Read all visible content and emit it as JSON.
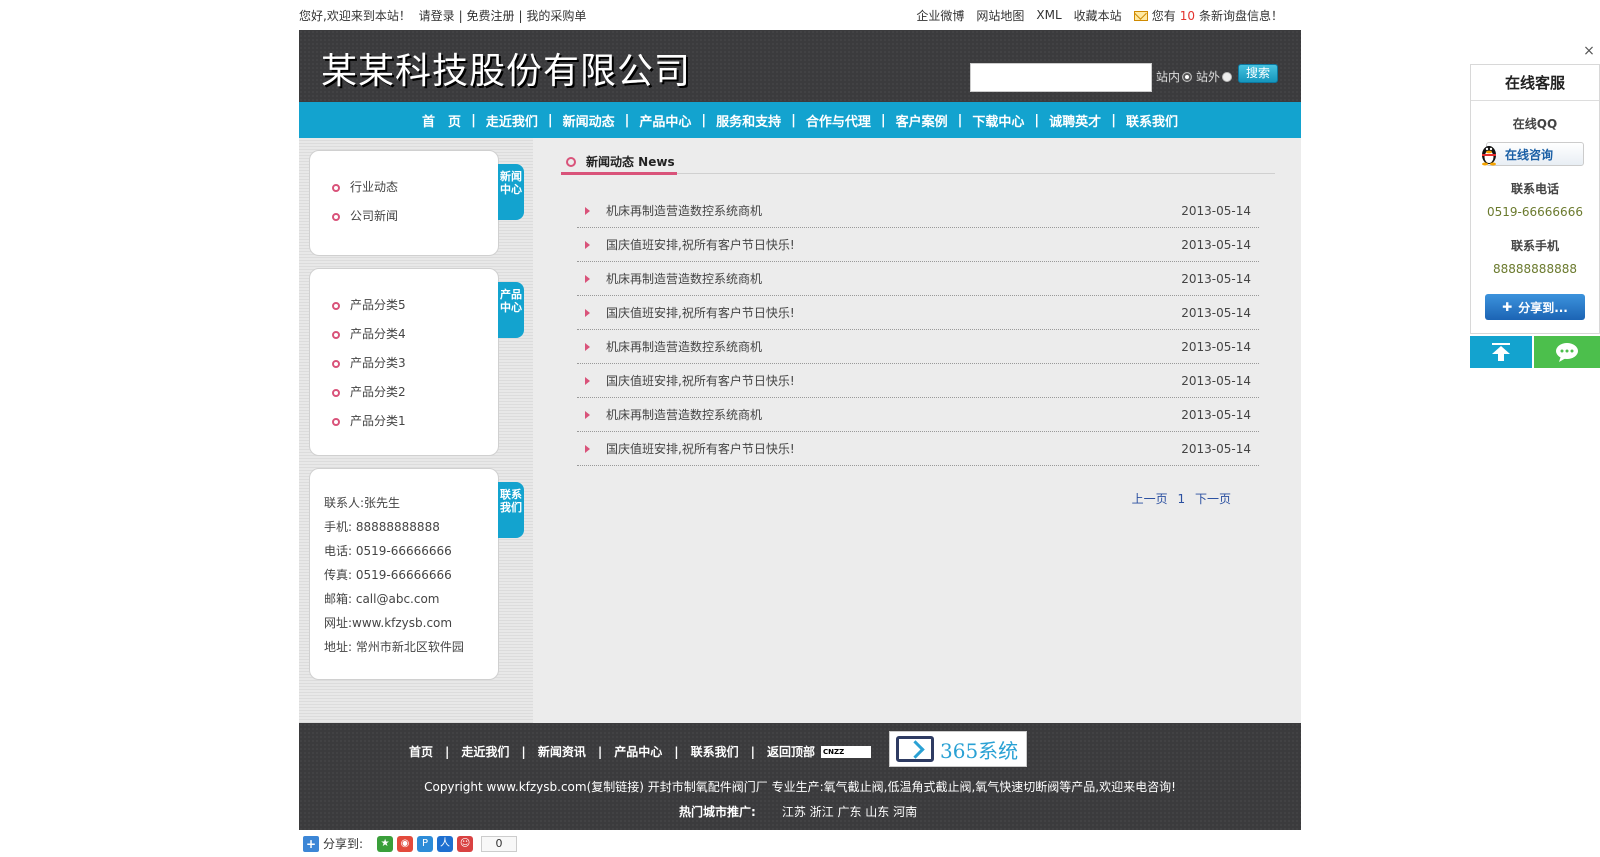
{
  "topbar": {
    "welcome": "您好,欢迎来到本站！",
    "login": "请登录",
    "register": "免费注册",
    "purchase": "我的采购单",
    "weibo": "企业微博",
    "sitemap": "网站地图",
    "xml": "XML",
    "favorite": "收藏本站",
    "notice_prefix": "您有",
    "notice_count": "10",
    "notice_suffix": "条新询盘信息！"
  },
  "header": {
    "company_name": "某某科技股份有限公司",
    "search_value": "",
    "radio_in": "站内",
    "radio_out": "站外",
    "search_button": "搜索"
  },
  "nav": [
    "首　页",
    "走近我们",
    "新闻动态",
    "产品中心",
    "服务和支持",
    "合作与代理",
    "客户案例",
    "下载中心",
    "诚聘英才",
    "联系我们"
  ],
  "sidebar": {
    "news_tab": "新闻中心",
    "news_items": [
      "行业动态",
      "公司新闻"
    ],
    "product_tab": "产品中心",
    "product_items": [
      "产品分类5",
      "产品分类4",
      "产品分类3",
      "产品分类2",
      "产品分类1"
    ],
    "contact_tab": "联系我们",
    "contact": {
      "person": "联系人:张先生",
      "mobile": "手机: 88888888888",
      "phone": "电话: 0519-66666666",
      "fax": "传真: 0519-66666666",
      "email": "邮箱: call@abc.com",
      "web": "网址:www.kfzysb.com",
      "address": "地址: 常州市新北区软件园"
    }
  },
  "content": {
    "title": "新闻动态  News",
    "news": [
      {
        "title": "机床再制造营造数控系统商机",
        "date": "2013-05-14"
      },
      {
        "title": "国庆值班安排,祝所有客户节日快乐!",
        "date": "2013-05-14"
      },
      {
        "title": "机床再制造营造数控系统商机",
        "date": "2013-05-14"
      },
      {
        "title": "国庆值班安排,祝所有客户节日快乐!",
        "date": "2013-05-14"
      },
      {
        "title": "机床再制造营造数控系统商机",
        "date": "2013-05-14"
      },
      {
        "title": "国庆值班安排,祝所有客户节日快乐!",
        "date": "2013-05-14"
      },
      {
        "title": "机床再制造营造数控系统商机",
        "date": "2013-05-14"
      },
      {
        "title": "国庆值班安排,祝所有客户节日快乐!",
        "date": "2013-05-14"
      }
    ],
    "pager_prev": "上一页",
    "pager_page": "1",
    "pager_next": "下一页"
  },
  "footer": {
    "links": [
      "首页",
      "走近我们",
      "新闻资讯",
      "产品中心",
      "联系我们",
      "返回顶部"
    ],
    "cnzz": "CNZZ",
    "badge_text": "365系统",
    "copyright": "Copyright www.kfzysb.com(复制链接) 开封市制氧配件阀门厂 专业生产:氧气截止阀,低温角式截止阀,氧气快速切断阀等产品,欢迎来电咨询!",
    "hot_label": "热门城市推广:",
    "cities": "江苏 浙江 广东 山东 河南"
  },
  "sharebar": {
    "label": "分享到:",
    "count": "0"
  },
  "side_panel": {
    "title": "在线客服",
    "qq_label": "在线QQ",
    "qq_button": "在线咨询",
    "phone_label": "联系电话",
    "phone": "0519-66666666",
    "mobile_label": "联系手机",
    "mobile": "88888888888",
    "share_button": "分享到...",
    "close": "×"
  },
  "colors": {
    "accent": "#13a3cf",
    "pink": "#d9537a",
    "header_bg": "#3b3b3d"
  }
}
